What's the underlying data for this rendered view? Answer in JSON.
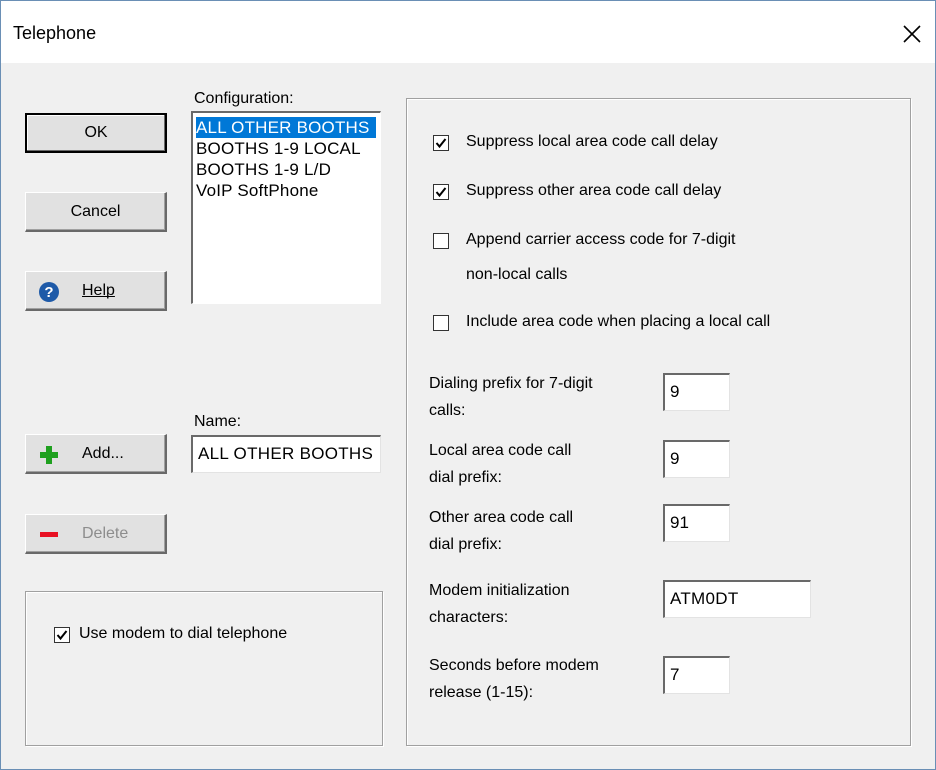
{
  "window": {
    "title": "Telephone"
  },
  "buttons": {
    "ok": "OK",
    "cancel": "Cancel",
    "help": "Help",
    "add": "Add...",
    "delete": "Delete"
  },
  "configuration": {
    "label": "Configuration:",
    "items": [
      "ALL OTHER BOOTHS",
      "BOOTHS 1-9 LOCAL",
      "BOOTHS 1-9 L/D",
      "VoIP SoftPhone"
    ],
    "selected_index": 0
  },
  "name": {
    "label": "Name:",
    "value": "ALL OTHER BOOTHS"
  },
  "modem_group": {
    "use_modem_label": "Use modem to dial telephone",
    "use_modem_checked": true
  },
  "options": {
    "suppress_local": {
      "label": "Suppress local area code call delay",
      "checked": true
    },
    "suppress_other": {
      "label": "Suppress other area code call delay",
      "checked": true
    },
    "append_carrier": {
      "line1": "Append carrier access code for 7-digit",
      "line2": "non-local calls",
      "checked": false
    },
    "include_area": {
      "label": "Include area code when placing a local call",
      "checked": false
    }
  },
  "fields": {
    "dialing_prefix": {
      "line1": "Dialing prefix for 7-digit",
      "line2": "calls:",
      "value": "9"
    },
    "local_prefix": {
      "line1": "Local area code call",
      "line2": "dial prefix:",
      "value": "9"
    },
    "other_prefix": {
      "line1": "Other area code call",
      "line2": "dial prefix:",
      "value": "91"
    },
    "modem_init": {
      "line1": "Modem initialization",
      "line2": "characters:",
      "value": "ATM0DT"
    },
    "modem_release": {
      "line1": "Seconds before modem",
      "line2": "release (1-15):",
      "value": "7"
    }
  },
  "colors": {
    "selection": "#0078d7",
    "add_icon": "#1fa01f",
    "delete_icon": "#e81123",
    "help_icon": "#1e5aa8"
  }
}
